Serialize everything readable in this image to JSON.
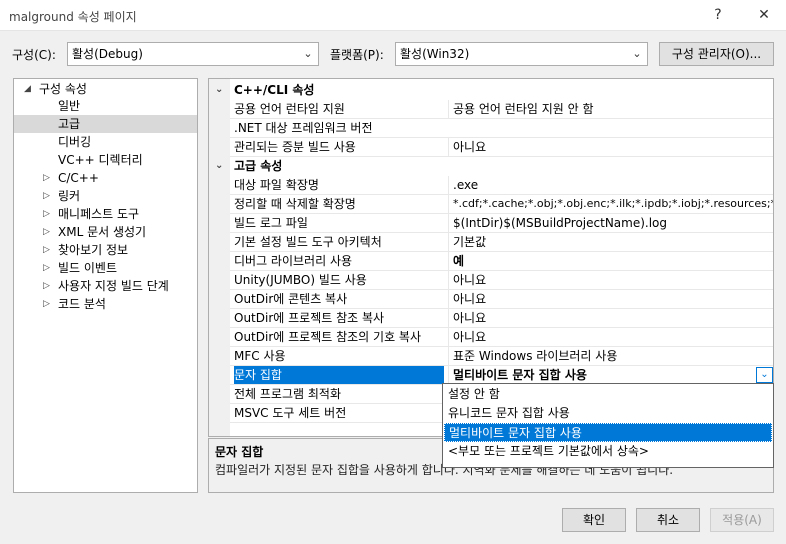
{
  "window": {
    "title": "malground 속성 페이지",
    "help_button": "?",
    "close_button": "✕"
  },
  "config": {
    "config_label": "구성(C):",
    "config_value": "활성(Debug)",
    "platform_label": "플랫폼(P):",
    "platform_value": "활성(Win32)",
    "manager_button": "구성 관리자(O)..."
  },
  "tree": {
    "items": [
      {
        "label": "구성 속성",
        "expander": "◢"
      },
      {
        "label": "일반",
        "expander": ""
      },
      {
        "label": "고급",
        "expander": ""
      },
      {
        "label": "디버깅",
        "expander": ""
      },
      {
        "label": "VC++ 디렉터리",
        "expander": ""
      },
      {
        "label": "C/C++",
        "expander": "▷"
      },
      {
        "label": "링커",
        "expander": "▷"
      },
      {
        "label": "매니페스트 도구",
        "expander": "▷"
      },
      {
        "label": "XML 문서 생성기",
        "expander": "▷"
      },
      {
        "label": "찾아보기 정보",
        "expander": "▷"
      },
      {
        "label": "빌드 이벤트",
        "expander": "▷"
      },
      {
        "label": "사용자 지정 빌드 단계",
        "expander": "▷"
      },
      {
        "label": "코드 분석",
        "expander": "▷"
      }
    ],
    "selected_index": 2
  },
  "grid": {
    "rows": [
      {
        "name": "C++/CLI 속성",
        "value": "",
        "category": true,
        "expander": "⌄"
      },
      {
        "name": "공용 언어 런타임 지원",
        "value": "공용 언어 런타임 지원 안 함"
      },
      {
        "name": ".NET 대상 프레임워크 버전",
        "value": ""
      },
      {
        "name": "관리되는 증분 빌드 사용",
        "value": "아니요"
      },
      {
        "name": "고급 속성",
        "value": "",
        "category": true,
        "expander": "⌄"
      },
      {
        "name": "대상 파일 확장명",
        "value": ".exe"
      },
      {
        "name": "정리할 때 삭제할 확장명",
        "value": "*.cdf;*.cache;*.obj;*.obj.enc;*.ilk;*.ipdb;*.iobj;*.resources;*.tlb;*.tli;*.tl"
      },
      {
        "name": "빌드 로그 파일",
        "value": "$(IntDir)$(MSBuildProjectName).log"
      },
      {
        "name": "기본 설정 빌드 도구 아키텍처",
        "value": "기본값"
      },
      {
        "name": "디버그 라이브러리 사용",
        "value": "예",
        "bold": true
      },
      {
        "name": "Unity(JUMBO) 빌드 사용",
        "value": "아니요"
      },
      {
        "name": "OutDir에 콘텐츠 복사",
        "value": "아니요"
      },
      {
        "name": "OutDir에 프로젝트 참조 복사",
        "value": "아니요"
      },
      {
        "name": "OutDir에 프로젝트 참조의 기호 복사",
        "value": "아니요"
      },
      {
        "name": "MFC 사용",
        "value": "표준 Windows 라이브러리 사용"
      },
      {
        "name": "문자 집합",
        "value": "멀티바이트 문자 집합 사용",
        "selected": true
      },
      {
        "name": "전체 프로그램 최적화",
        "value": ""
      },
      {
        "name": "MSVC 도구 세트 버전",
        "value": ""
      }
    ],
    "dropdown_icon": "chevron-down"
  },
  "dropdown": {
    "options": [
      "설정 안 함",
      "유니코드 문자 집합 사용",
      "멀티바이트 문자 집합 사용",
      "<부모 또는 프로젝트 기본값에서 상속>"
    ],
    "selected_index": 2
  },
  "description": {
    "title": "문자 집합",
    "text": "컴파일러가 지정된 문자 집합을 사용하게 합니다. 지역화 문제를 해결하는 데 도움이 됩니다."
  },
  "footer": {
    "ok": "확인",
    "cancel": "취소",
    "apply": "적용(A)"
  }
}
